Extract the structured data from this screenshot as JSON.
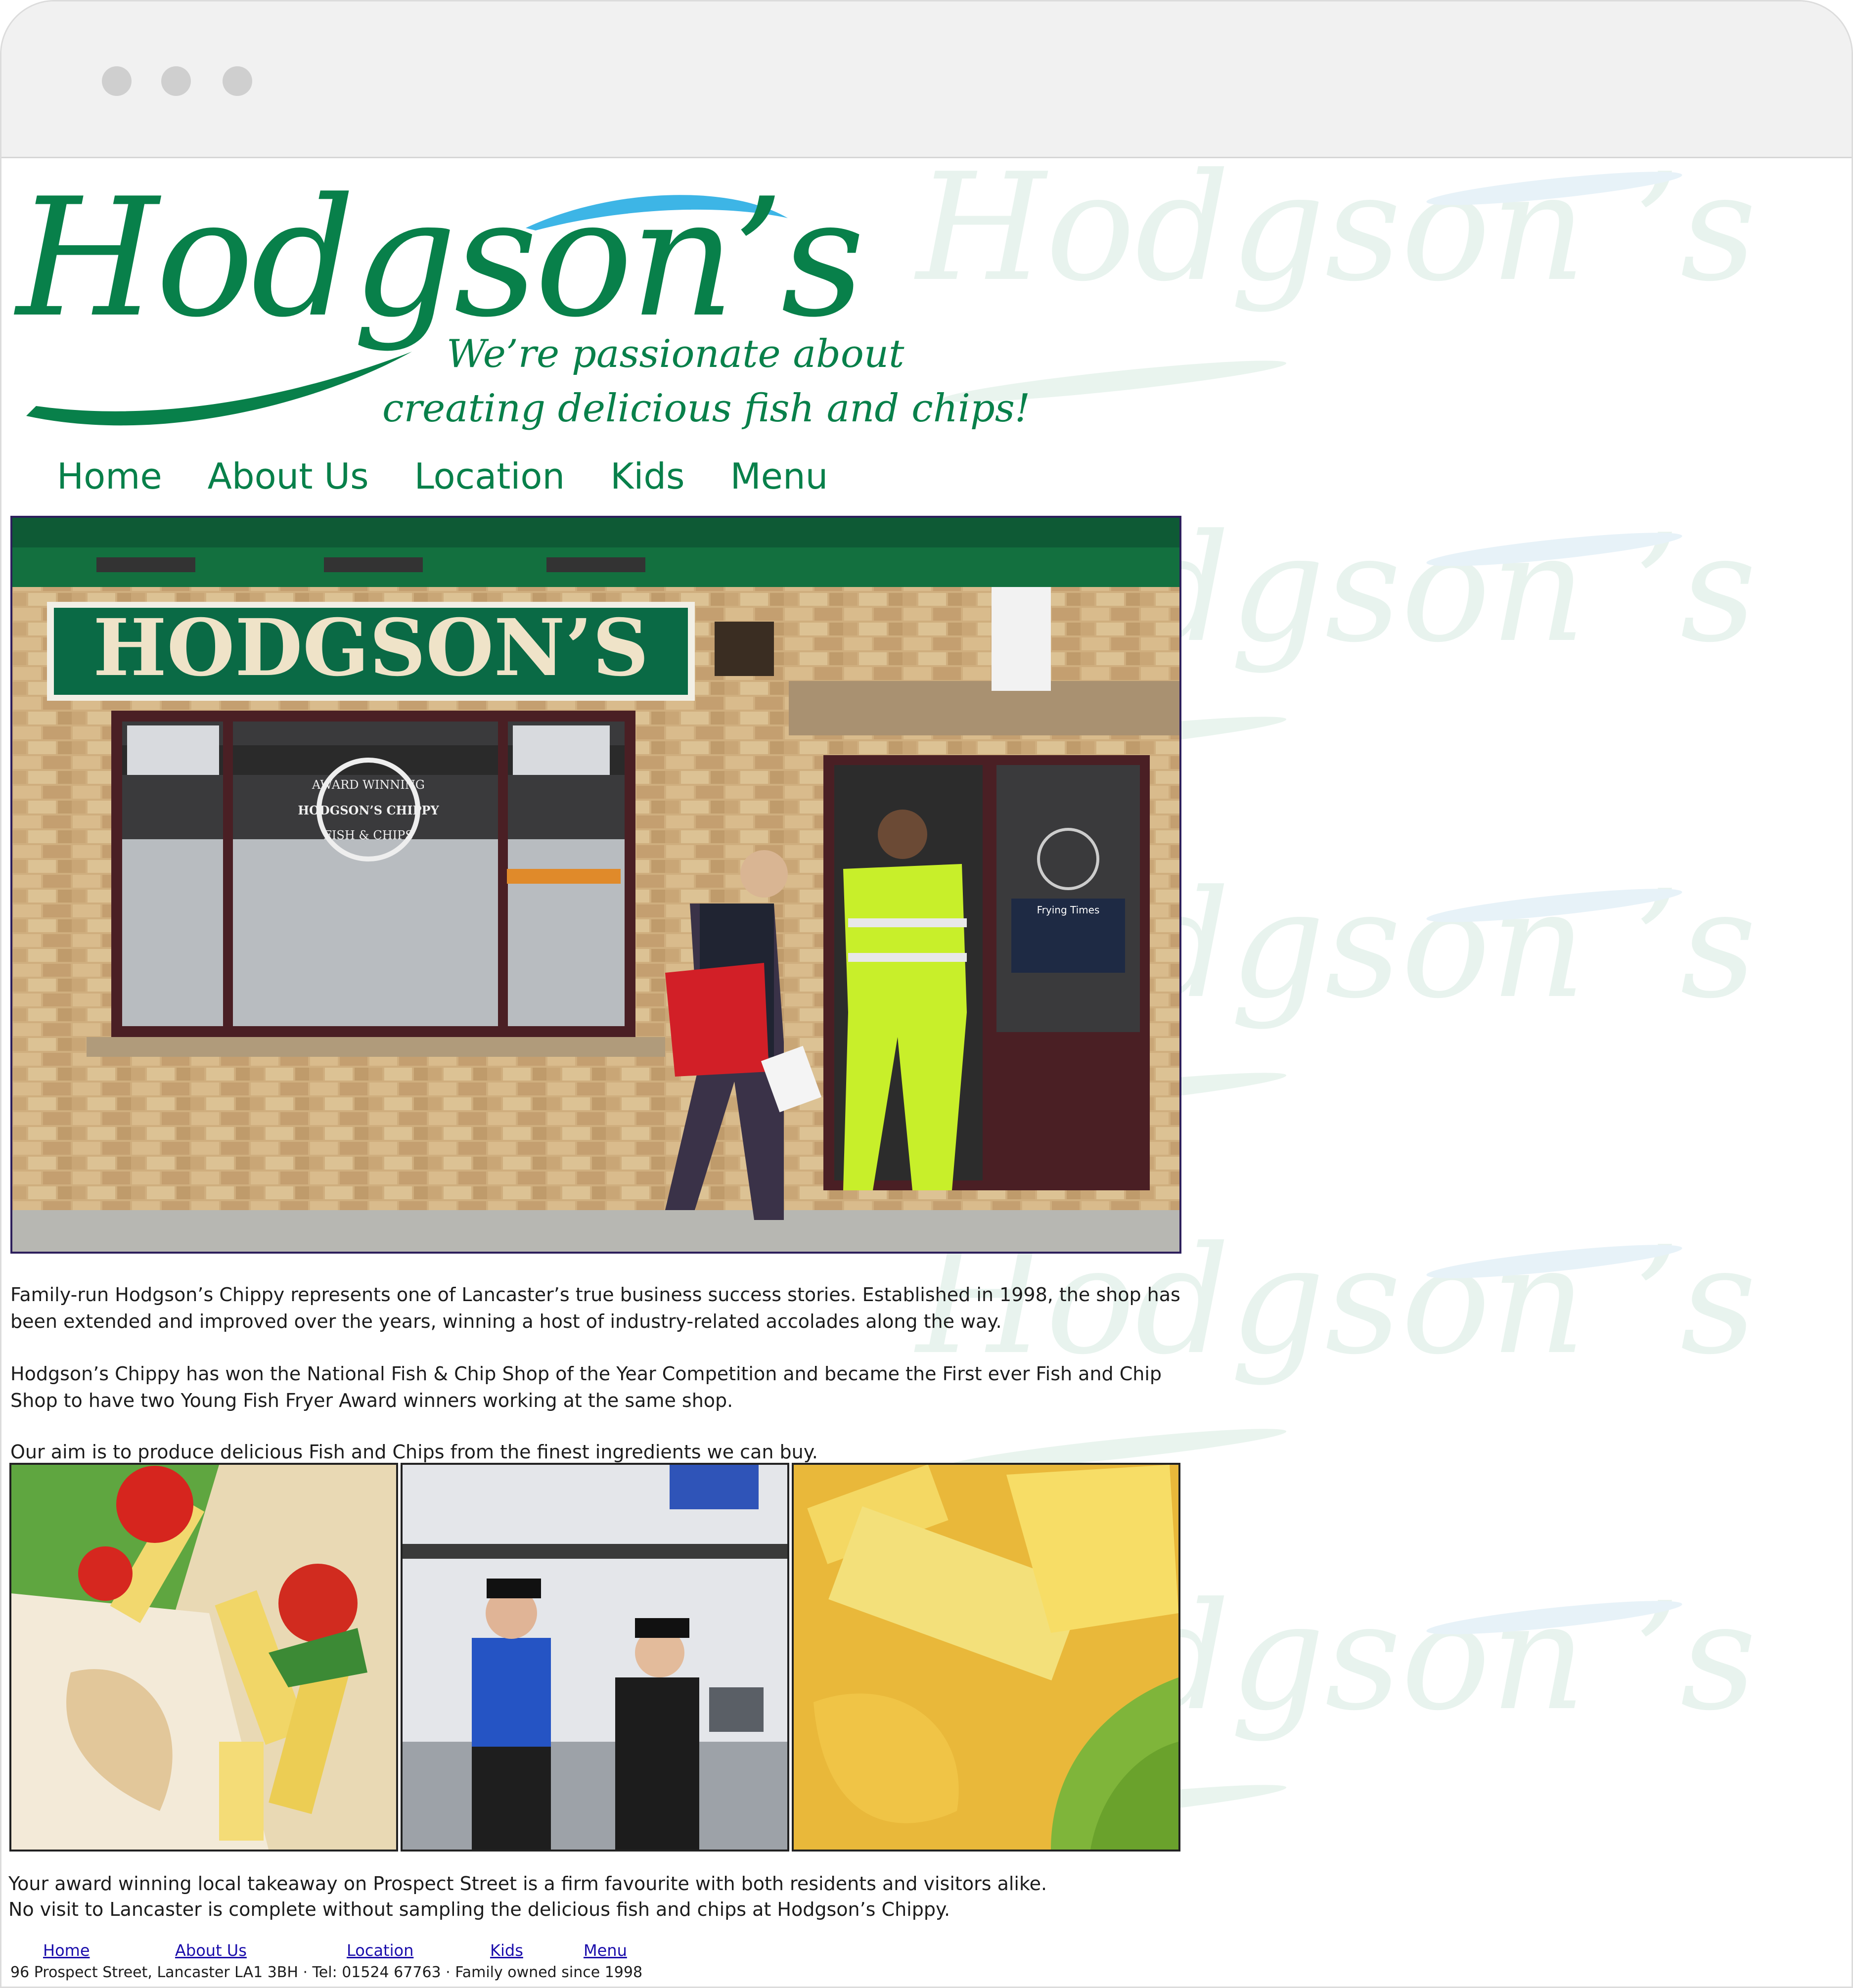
{
  "logo": {
    "wordmark": "Hodgson’s",
    "tagline_line1": "We’re passionate about",
    "tagline_line2": "creating delicious fish and chips!"
  },
  "nav": [
    {
      "label": "Home"
    },
    {
      "label": "About Us"
    },
    {
      "label": "Location"
    },
    {
      "label": "Kids"
    },
    {
      "label": "Menu"
    }
  ],
  "hero": {
    "shop_sign": "HODGSON’S",
    "window_badge_top": "AWARD WINNING",
    "window_badge_mid": "HODGSON’S CHIPPY",
    "window_badge_bottom": "FISH & CHIPS",
    "door_notice_title": "Frying Times"
  },
  "content": {
    "para1_line1": "Family-run Hodgson’s Chippy represents one of Lancaster’s true business success stories. Established in 1998, the shop has",
    "para1_line2": "been extended and improved over the years, winning a host of industry-related accolades along the way.",
    "para2_line1": "Hodgson’s Chippy has won the National Fish & Chip Shop of the Year Competition and became the First ever Fish and Chip",
    "para2_line2": "Shop to have two Young Fish Fryer Award winners working at the same shop.",
    "para3": "Our aim is to produce delicious Fish and Chips from the finest ingredients we can buy.",
    "closing_line1": "Your award winning local takeaway on Prospect Street is a firm favourite with both residents and visitors alike.",
    "closing_line2": "No visit to Lancaster is complete without sampling the delicious fish and chips at Hodgson’s Chippy."
  },
  "footer": {
    "links": [
      "Home",
      "About Us",
      "Location",
      "Kids",
      "Menu"
    ],
    "address": "96 Prospect Street, Lancaster LA1 3BH · Tel: 01524 67763 · Family owned since 1998"
  },
  "colors": {
    "brand_green": "#08804a",
    "accent_blue": "#3db5e6",
    "link_blue": "#1a0dab"
  }
}
